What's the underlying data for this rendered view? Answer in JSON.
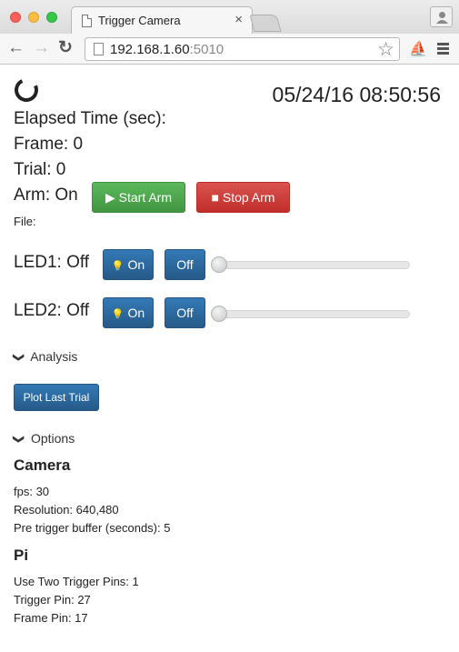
{
  "browser": {
    "tab_title": "Trigger Camera",
    "tab_close": "×",
    "url_host": "192.168.1.60",
    "url_port": ":5010",
    "icons": [
      "back-arrow-icon",
      "forward-arrow-icon",
      "reload-icon",
      "bookmark-star-icon",
      "menu-icon",
      "profile-icon"
    ]
  },
  "status": {
    "datetime": "05/24/16 08:50:56",
    "elapsed": "Elapsed Time (sec):",
    "frame": "Frame: 0",
    "trial": "Trial: 0",
    "arm": "Arm: On",
    "file": "File:"
  },
  "arm_controls": {
    "start_label": "Start Arm",
    "stop_label": "Stop Arm",
    "colors": {
      "start": "#5cb85c",
      "stop": "#d9534f"
    }
  },
  "leds": [
    {
      "label": "LED1: Off",
      "on_label": "On",
      "off_label": "Off",
      "level": 0
    },
    {
      "label": "LED2: Off",
      "on_label": "On",
      "off_label": "Off",
      "level": 0
    }
  ],
  "analysis": {
    "toggle_label": "Analysis",
    "plot_button": "Plot Last Trial"
  },
  "options": {
    "toggle_label": "Options",
    "camera": {
      "heading": "Camera",
      "fps": "fps: 30",
      "resolution": "Resolution: 640,480",
      "pre_trigger": "Pre trigger buffer (seconds): 5"
    },
    "pi": {
      "heading": "Pi",
      "two_pins": "Use Two Trigger Pins: 1",
      "trigger_pin": "Trigger Pin: 27",
      "frame_pin": "Frame Pin: 17"
    }
  },
  "accent_color": "#337ab7"
}
